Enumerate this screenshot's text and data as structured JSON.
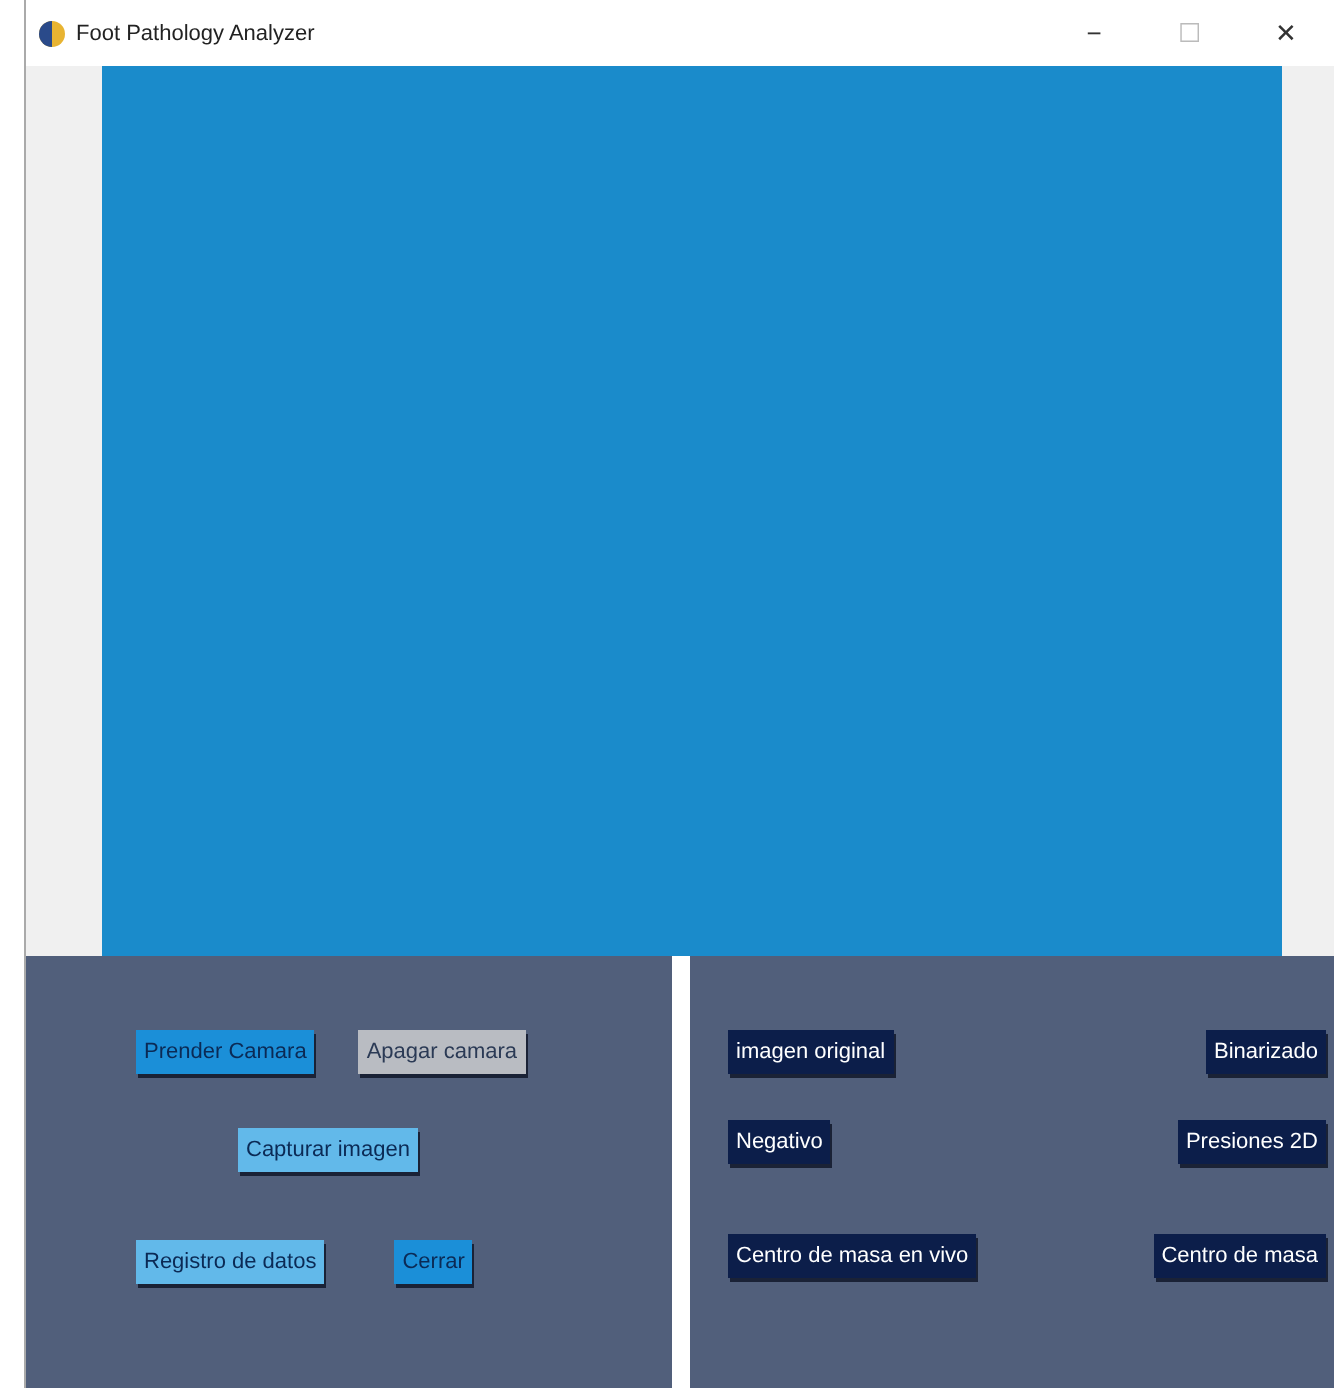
{
  "window": {
    "title": "Foot Pathology Analyzer",
    "controls": [
      "−",
      "☐",
      "✕"
    ]
  },
  "camera_view": {
    "kind": "empty"
  },
  "control_panel": {
    "rows": [
      [
        {
          "label": "Prender Camara",
          "kind": "accent"
        },
        {
          "label": "Apagar camara",
          "kind": "muted"
        }
      ],
      [
        {
          "label": "Capturar imagen",
          "kind": "light"
        }
      ],
      [
        {
          "label": "Registro de datos",
          "kind": "light"
        },
        {
          "label": "Cerrar",
          "kind": "accent"
        }
      ]
    ]
  },
  "view_panel": {
    "rows": [
      [
        {
          "label": "imagen original",
          "kind": "dark"
        },
        {
          "label": "Binarizado",
          "kind": "dark"
        }
      ],
      [
        {
          "label": "Negativo",
          "kind": "dark"
        },
        {
          "label": "Presiones 2D",
          "kind": "dark"
        }
      ],
      [
        {
          "label": "Centro de masa en vivo",
          "kind": "dark"
        },
        {
          "label": "Centro de masa",
          "kind": "dark"
        }
      ]
    ]
  }
}
